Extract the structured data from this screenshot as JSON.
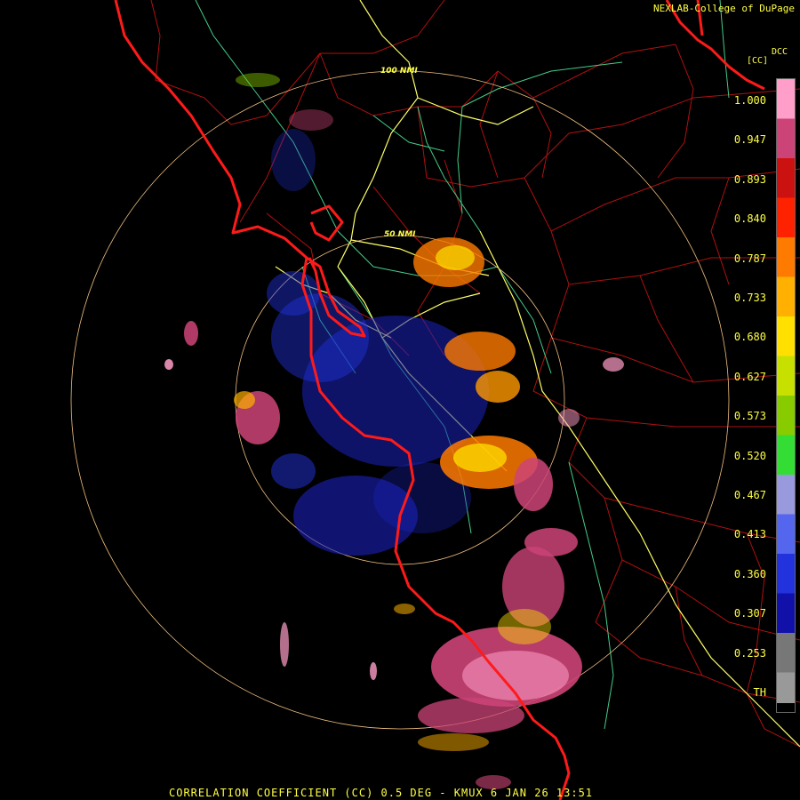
{
  "header": {
    "credit": "NEXLAB-College of DuPage",
    "product_code": "DCC",
    "product_field": "[CC]"
  },
  "range_rings": [
    "100 NMI",
    "50 NMI"
  ],
  "legend": {
    "ticks": [
      "1.000",
      "0.947",
      "0.893",
      "0.840",
      "0.787",
      "0.733",
      "0.680",
      "0.627",
      "0.573",
      "0.520",
      "0.467",
      "0.413",
      "0.360",
      "0.307",
      "0.253",
      "TH"
    ],
    "colors": [
      "#ff9ec8",
      "#cc4477",
      "#cc1111",
      "#ff2200",
      "#ff7a00",
      "#ffb000",
      "#ffe000",
      "#c8e000",
      "#88cc00",
      "#33dd33",
      "#9999dd",
      "#5566ee",
      "#2233dd",
      "#1111aa",
      "#777777",
      "#999999"
    ]
  },
  "footer": {
    "caption": "CORRELATION COEFFICIENT (CC) 0.5 DEG - KMUX 6 JAN 26 13:51"
  },
  "colors": {
    "coast": "#ff1a1a",
    "county": "#b01010",
    "highway": "#ffff66",
    "road": "#44cc88",
    "ring": "#f0c080"
  }
}
